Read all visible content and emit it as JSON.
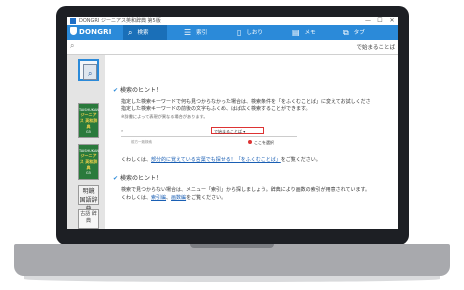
{
  "titlebar": {
    "app_name": "DONGRI",
    "subtitle": "ジーニアス英和辞典 第5版",
    "minimize": "—",
    "maximize": "☐",
    "close": "✕"
  },
  "toolbar": {
    "logo": "DONGRI",
    "search": "検索",
    "index": "索引",
    "bookmark": "しおり",
    "memo": "メモ",
    "tab": "タブ",
    "icons": {
      "search": "search-icon",
      "index": "list-icon",
      "bookmark": "bookmark-icon",
      "memo": "memo-icon",
      "tab": "tab-icon"
    }
  },
  "search": {
    "value": "",
    "placeholder_hint": "で始まることば",
    "icon": "search-icon"
  },
  "sidebar": {
    "books": [
      {
        "name": "検索",
        "icon": "magnifier-book-icon"
      },
      {
        "publisher": "TAISHUKAN",
        "title": "ジーニアス 英和辞典",
        "edition": "G5"
      },
      {
        "publisher": "TAISHUKAN",
        "title": "ジーニアス 英和辞典",
        "edition": "G5"
      },
      {
        "title": "明鏡 国語辞典"
      },
      {
        "title": "古語 辞典"
      }
    ]
  },
  "content": {
    "hint1": {
      "heading": "検索のヒント！",
      "line1": "指定した検索キーワードで何も見つからなかった場合は、検索条件を「をふくむことば」に変えてお試しくださ",
      "line2": "指定した検索キーワードの前後の文字もふくめ、はば広く検索することができます。",
      "note": "※辞書によって表現が異なる場合があります。",
      "demo_select": "で始まることば",
      "demo_sub": "前方一致検索",
      "callout": "ここを選択",
      "more_prefix": "くわしくは、",
      "more_link": "部分的に覚えている言葉でも探せる！「をふくむことば」",
      "more_suffix": "をご覧ください。"
    },
    "hint2": {
      "heading": "検索のヒント！",
      "line1": "検索で見つからない場合は、メニュー「索引」から探しましょう。辞典により画数の索引が用意されています。",
      "more_prefix": "くわしくは、",
      "link1": "索引編",
      "sep": "、",
      "link2": "画数編",
      "more_suffix": "をご覧ください。"
    }
  },
  "colors": {
    "accent": "#2b8ad9",
    "accent_dark": "#1a6fb8",
    "dictionary_green": "#2a7a3c",
    "link": "#1a5fb4",
    "callout_red": "#dd3333"
  }
}
